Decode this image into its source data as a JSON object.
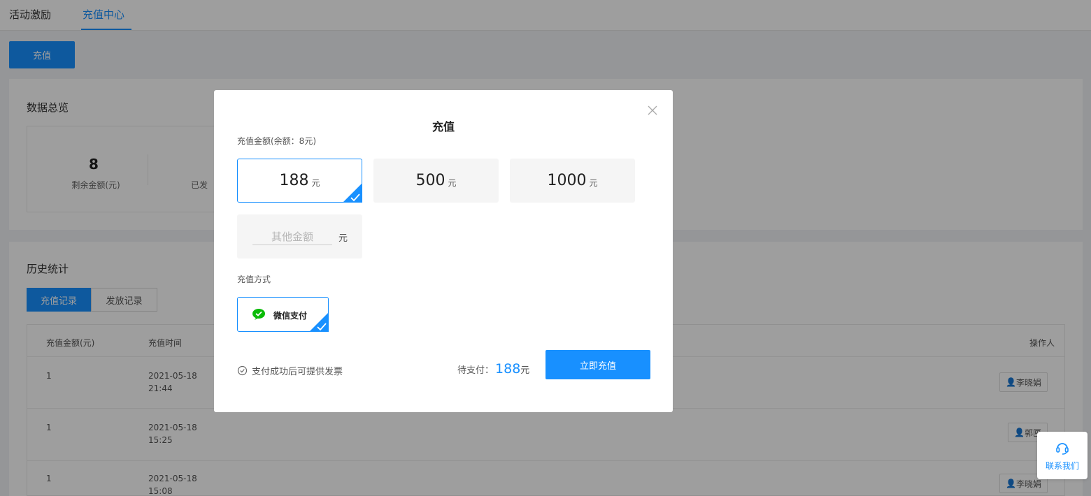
{
  "nav": {
    "tabs": [
      {
        "label": "活动激励"
      },
      {
        "label": "充值中心"
      }
    ]
  },
  "actions": {
    "recharge_label": "充值"
  },
  "overview": {
    "title": "数据总览",
    "balance_value": "8",
    "balance_label": "剩余金额(元)",
    "issued_label_partial": "已发"
  },
  "history": {
    "title": "历史统计",
    "tabs": [
      "充值记录",
      "发放记录"
    ],
    "columns": [
      "充值金额(元)",
      "充值时间",
      "操作人"
    ],
    "rows": [
      {
        "amount": "1",
        "date": "2021-05-18",
        "time": "21:44",
        "operator": "李晓娟"
      },
      {
        "amount": "1",
        "date": "2021-05-18",
        "time": "15:25",
        "operator": "郭匣"
      },
      {
        "amount": "1",
        "date": "2021-05-18",
        "time": "15:08",
        "operator": "李晓娟"
      }
    ]
  },
  "modal": {
    "title": "充值",
    "amount_label": "充值金额(余额：8元)",
    "options": [
      {
        "value": "188",
        "unit": "元",
        "selected": true
      },
      {
        "value": "500",
        "unit": "元",
        "selected": false
      },
      {
        "value": "1000",
        "unit": "元",
        "selected": false
      }
    ],
    "other_placeholder": "其他金额",
    "other_unit": "元",
    "method_label": "充值方式",
    "method_name": "微信支付",
    "invoice_note": "支付成功后可提供发票",
    "pending_label": "待支付：",
    "pending_amount": "188",
    "pending_unit": "元",
    "pay_button": "立即充值"
  },
  "contact": {
    "label": "联系我们"
  },
  "colors": {
    "accent": "#1890ff",
    "wechat": "#09bb07"
  }
}
